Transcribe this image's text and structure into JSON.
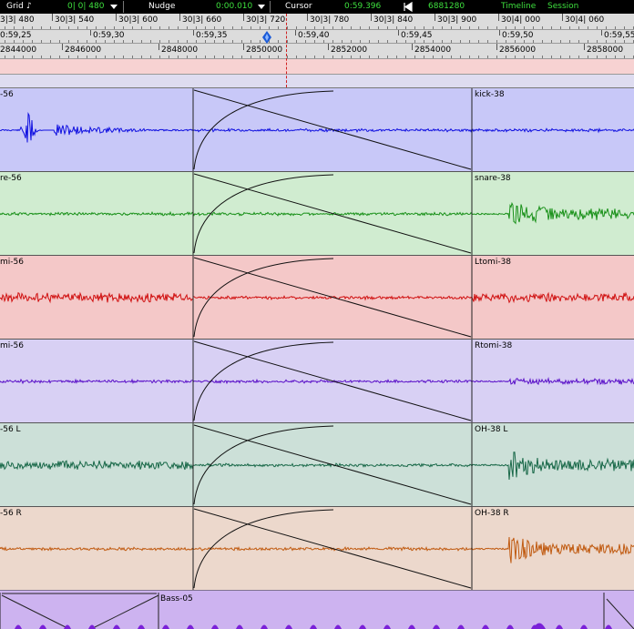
{
  "toolbar": {
    "grid_label": "Grid",
    "grid_value": "0| 0| 480",
    "nudge_label": "Nudge",
    "nudge_value": "0:00.010",
    "cursor_label": "Cursor",
    "cursor_value": "0:59.396",
    "sample_value": "6881280",
    "timeline_label": "Timeline",
    "session_label": "Session",
    "note_icon": "eighth-note-icon",
    "sample_icon": "sample-position-icon"
  },
  "bars_ruler": [
    "3|3| 480",
    "30|3| 540",
    "30|3| 600",
    "30|3| 660",
    "30|3| 720",
    "30|3| 780",
    "30|3| 840",
    "30|3| 900",
    "30|4| 000",
    "30|4| 060"
  ],
  "time_ruler": [
    "0:59,25",
    "0:59,30",
    "0:59,35",
    "0:59,40",
    "0:59,45",
    "0:59,50",
    "0:59,55"
  ],
  "samples_ruler": [
    "2844000",
    "2846000",
    "2848000",
    "2850000",
    "2852000",
    "2854000",
    "2856000",
    "2858000"
  ],
  "tracks": [
    {
      "left_name": "-56",
      "right_name": "kick-38",
      "color": "#c8c8f8",
      "wave": "#1010e0"
    },
    {
      "left_name": "re-56",
      "right_name": "snare-38",
      "color": "#d0ecd0",
      "wave": "#189018"
    },
    {
      "left_name": "mi-56",
      "right_name": "Ltomi-38",
      "color": "#f4c8c8",
      "wave": "#d01010"
    },
    {
      "left_name": "mi-56",
      "right_name": "Rtomi-38",
      "color": "#d8d0f4",
      "wave": "#5a10c8"
    },
    {
      "left_name": "-56 L",
      "right_name": "OH-38 L",
      "color": "#cce0d8",
      "wave": "#186848"
    },
    {
      "left_name": "-56 R",
      "right_name": "OH-38 R",
      "color": "#ecd8cc",
      "wave": "#c05a10"
    }
  ],
  "bass_region": {
    "name": "Bass-05",
    "color": "#cdb3f0",
    "wave": "#7a20d8"
  },
  "colors": {
    "cursor_line": "#d02020",
    "topbar_value": "#3ee03e"
  }
}
